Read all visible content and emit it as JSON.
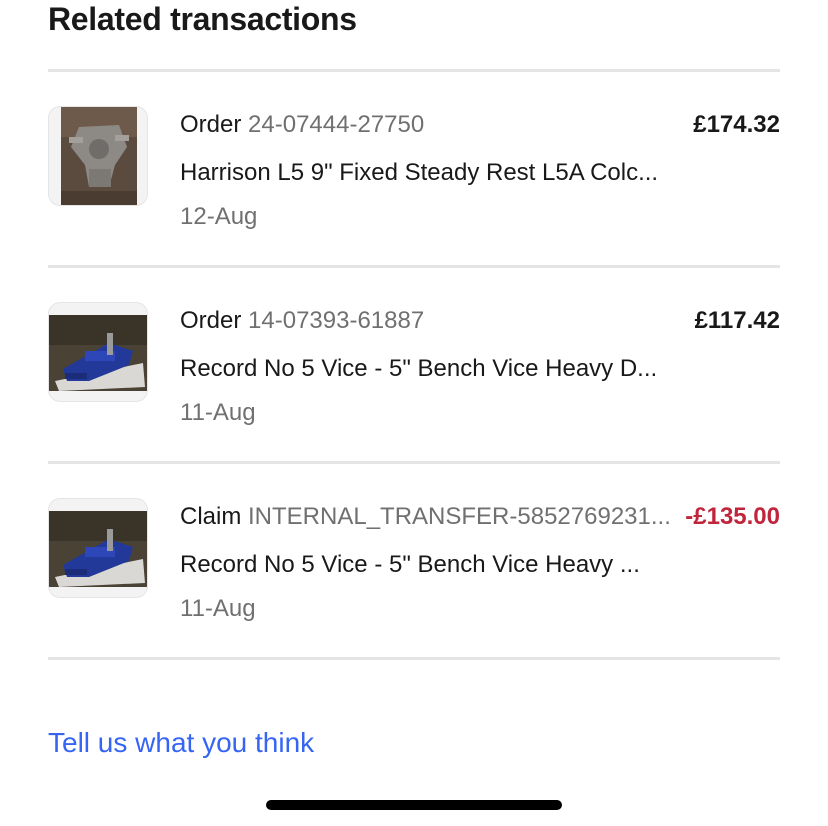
{
  "section": {
    "title": "Related transactions"
  },
  "transactions": [
    {
      "type": "Order",
      "id": "24-07444-27750",
      "amount": "£174.32",
      "title": "Harrison L5 9\" Fixed Steady Rest L5A Colc...",
      "date": "12-Aug",
      "thumbnail": "steady-rest-photo"
    },
    {
      "type": "Order",
      "id": "14-07393-61887",
      "amount": "£117.42",
      "title": "Record No 5 Vice - 5\" Bench Vice Heavy D...",
      "date": "11-Aug",
      "thumbnail": "bench-vice-photo"
    },
    {
      "type": "Claim",
      "id": "INTERNAL_TRANSFER-5852769231...",
      "amount": "-£135.00",
      "title": "Record No 5 Vice - 5\" Bench Vice Heavy ...",
      "date": "11-Aug",
      "thumbnail": "bench-vice-photo"
    }
  ],
  "feedback": {
    "label": "Tell us what you think"
  },
  "colors": {
    "link": "#3665f3",
    "negative_amount": "#c0253b",
    "secondary_text": "#707070",
    "divider": "#e5e5e5"
  }
}
